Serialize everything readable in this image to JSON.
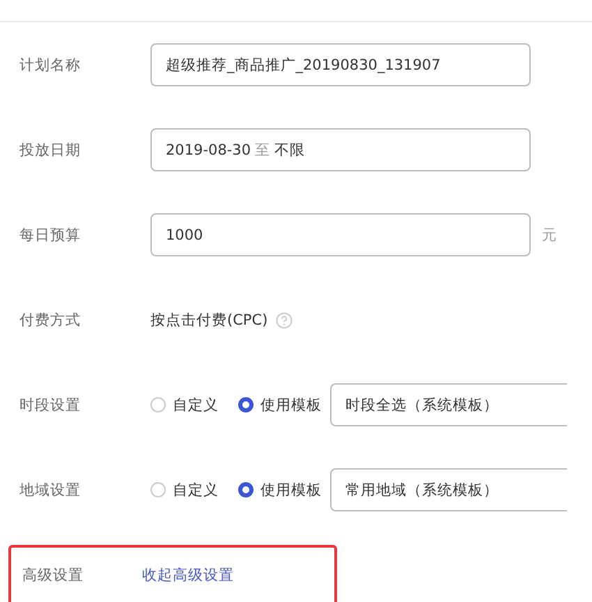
{
  "fields": [
    {
      "kind": "input",
      "label": "计划名称",
      "value": "超级推荐_商品推广_20190830_131907"
    },
    {
      "kind": "date",
      "label": "投放日期",
      "start": "2019-08-30",
      "separator": "至",
      "end": "不限"
    },
    {
      "kind": "input",
      "label": "每日预算",
      "value": "1000",
      "unit": "元"
    },
    {
      "kind": "text",
      "label": "付费方式",
      "value": "按点击付费(CPC)",
      "help": true
    },
    {
      "kind": "radio",
      "label": "时段设置",
      "options": [
        {
          "label": "自定义",
          "selected": false
        },
        {
          "label": "使用模板",
          "selected": true
        }
      ],
      "select": "时段全选（系统模板）"
    },
    {
      "kind": "radio",
      "label": "地域设置",
      "options": [
        {
          "label": "自定义",
          "selected": false
        },
        {
          "label": "使用模板",
          "selected": true
        }
      ],
      "select": "常用地域（系统模板）"
    },
    {
      "kind": "link",
      "label": "高级设置",
      "link": "收起高级设置",
      "highlighted": true
    }
  ]
}
